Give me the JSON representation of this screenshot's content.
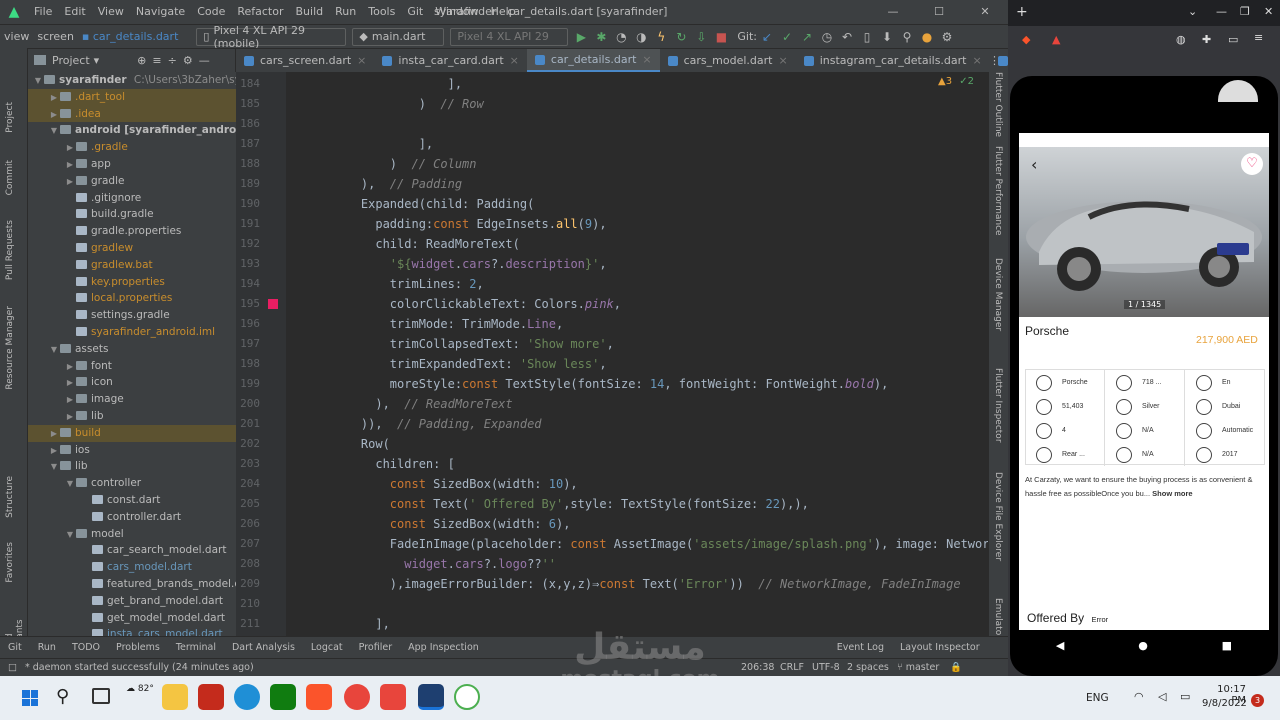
{
  "window": {
    "title": "syarafinder - car_details.dart [syarafinder]",
    "menu": [
      "File",
      "Edit",
      "View",
      "Navigate",
      "Code",
      "Refactor",
      "Build",
      "Run",
      "Tools",
      "Git",
      "Window",
      "Help"
    ],
    "controls": [
      "—",
      "☐",
      "✕"
    ]
  },
  "toolbar": {
    "crumbs": [
      "view",
      "screen"
    ],
    "file": "car_details.dart",
    "device": "Pixel 4 XL API 29 (mobile)",
    "config": "main.dart",
    "target": "Pixel 4 XL API 29",
    "git_label": "Git:"
  },
  "project": {
    "header": "Project",
    "root": "syarafinder",
    "root_path": "C:\\Users\\3bZaher\\syarafin",
    "items": [
      {
        "d": 1,
        "t": ".dart_tool",
        "hl": true,
        "fold": true,
        "col": "#c88d2d"
      },
      {
        "d": 1,
        "t": ".idea",
        "hl": true,
        "fold": true,
        "col": "#c88d2d"
      },
      {
        "d": 1,
        "t": "android [syarafinder_android]",
        "fold": true,
        "open": true,
        "bold": true
      },
      {
        "d": 2,
        "t": ".gradle",
        "fold": true,
        "col": "#c88d2d"
      },
      {
        "d": 2,
        "t": "app",
        "fold": true
      },
      {
        "d": 2,
        "t": "gradle",
        "fold": true
      },
      {
        "d": 2,
        "t": ".gitignore"
      },
      {
        "d": 2,
        "t": "build.gradle"
      },
      {
        "d": 2,
        "t": "gradle.properties"
      },
      {
        "d": 2,
        "t": "gradlew",
        "col": "#c88d2d"
      },
      {
        "d": 2,
        "t": "gradlew.bat",
        "col": "#c88d2d"
      },
      {
        "d": 2,
        "t": "key.properties",
        "col": "#c88d2d"
      },
      {
        "d": 2,
        "t": "local.properties",
        "col": "#c88d2d"
      },
      {
        "d": 2,
        "t": "settings.gradle"
      },
      {
        "d": 2,
        "t": "syarafinder_android.iml",
        "col": "#c88d2d"
      },
      {
        "d": 1,
        "t": "assets",
        "fold": true,
        "open": true
      },
      {
        "d": 2,
        "t": "font",
        "fold": true
      },
      {
        "d": 2,
        "t": "icon",
        "fold": true
      },
      {
        "d": 2,
        "t": "image",
        "fold": true
      },
      {
        "d": 2,
        "t": "lib",
        "fold": true
      },
      {
        "d": 1,
        "t": "build",
        "hl": true,
        "fold": true,
        "col": "#c88d2d"
      },
      {
        "d": 1,
        "t": "ios",
        "fold": true
      },
      {
        "d": 1,
        "t": "lib",
        "fold": true,
        "open": true
      },
      {
        "d": 2,
        "t": "controller",
        "fold": true,
        "open": true
      },
      {
        "d": 3,
        "t": "const.dart"
      },
      {
        "d": 3,
        "t": "controller.dart"
      },
      {
        "d": 2,
        "t": "model",
        "fold": true,
        "open": true
      },
      {
        "d": 3,
        "t": "car_search_model.dart"
      },
      {
        "d": 3,
        "t": "cars_model.dart",
        "col": "#6897bb"
      },
      {
        "d": 3,
        "t": "featured_brands_model.dart"
      },
      {
        "d": 3,
        "t": "get_brand_model.dart"
      },
      {
        "d": 3,
        "t": "get_model_model.dart"
      },
      {
        "d": 3,
        "t": "insta_cars_model.dart",
        "col": "#6897bb"
      }
    ]
  },
  "tabs": [
    "cars_screen.dart",
    "insta_car_card.dart",
    "car_details.dart",
    "cars_model.dart",
    "instagram_car_details.dart",
    "insta_cars_model.dart"
  ],
  "active_tab": 2,
  "inspections": {
    "warnings": "▲3",
    "weak": "✓2"
  },
  "code_lines": [
    {
      "n": 184,
      "h": "                ],"
    },
    {
      "n": 185,
      "h": "            )  <span class='c'>// Row</span>"
    },
    {
      "n": 186,
      "h": ""
    },
    {
      "n": 187,
      "h": "            ],"
    },
    {
      "n": 188,
      "h": "        )  <span class='c'>// Column</span>"
    },
    {
      "n": 189,
      "h": "    ),  <span class='c'>// Padding</span>"
    },
    {
      "n": 190,
      "h": "    Expanded(child: Padding("
    },
    {
      "n": 191,
      "h": "      padding:<span class='k'>const</span> EdgeInsets.<span class='f'>all</span>(<span class='n'>9</span>),"
    },
    {
      "n": 192,
      "h": "      child: ReadMoreText("
    },
    {
      "n": 193,
      "h": "        <span class='s'>'${</span><span class='p'>widget</span>.<span class='p'>cars</span>?.<span class='p'>description</span><span class='s'>}'</span>,"
    },
    {
      "n": 194,
      "h": "        trimLines: <span class='n'>2</span>,"
    },
    {
      "n": 195,
      "h": "        colorClickableText: Colors.<span class='p' style='font-style:italic'>pink</span>,"
    },
    {
      "n": 196,
      "h": "        trimMode: TrimMode.<span class='p'>Line</span>,"
    },
    {
      "n": 197,
      "h": "        trimCollapsedText: <span class='s'>'Show more'</span>,"
    },
    {
      "n": 198,
      "h": "        trimExpandedText: <span class='s'>'Show less'</span>,"
    },
    {
      "n": 199,
      "h": "        moreStyle:<span class='k'>const</span> TextStyle(fontSize: <span class='n'>14</span>, fontWeight: FontWeight.<span class='p' style='font-style:italic'>bold</span>),"
    },
    {
      "n": 200,
      "h": "      ),  <span class='c'>// ReadMoreText</span>"
    },
    {
      "n": 201,
      "h": "    )),  <span class='c'>// Padding, Expanded</span>"
    },
    {
      "n": 202,
      "h": "    Row("
    },
    {
      "n": 203,
      "h": "      children: ["
    },
    {
      "n": 204,
      "h": "        <span class='k'>const</span> SizedBox(width: <span class='n'>10</span>),"
    },
    {
      "n": 205,
      "h": "        <span class='k'>const</span> Text(<span class='s'>' Offered By'</span>,style: TextStyle(fontSize: <span class='n'>22</span>),),"
    },
    {
      "n": 206,
      "h": "        <span class='k'>const</span> SizedBox(width: <span class='n'>6</span>),"
    },
    {
      "n": 207,
      "h": "        FadeInImage(placeholder: <span class='k'>const</span> AssetImage(<span class='s'>'assets/image/splash.png'</span>), image: NetworkI"
    },
    {
      "n": 208,
      "h": "          <span class='p'>widget</span>.<span class='p'>cars</span>?.<span class='p'>logo</span>??<span class='s'>''</span>"
    },
    {
      "n": 209,
      "h": "        ),imageErrorBuilder: (x,y,z)⇒<span class='k'>const</span> Text(<span class='s'>'Error'</span>))  <span class='c'>// NetworkImage, FadeInImage</span>"
    },
    {
      "n": 210,
      "h": ""
    },
    {
      "n": 211,
      "h": "      ],"
    }
  ],
  "bottom_tools": [
    "Git",
    "Run",
    "TODO",
    "Problems",
    "Terminal",
    "Dart Analysis",
    "Logcat",
    "Profiler",
    "App Inspection",
    "Event Log",
    "Layout Inspector"
  ],
  "status": {
    "message": "* daemon started successfully (24 minutes ago)",
    "position": "206:38",
    "line_sep": "CRLF",
    "encoding": "UTF-8",
    "indent": "2 spaces",
    "branch": "master"
  },
  "left_tools": [
    "Project",
    "Commit",
    "Pull Requests",
    "Resource Manager",
    "Structure",
    "Favorites",
    "Build Variants"
  ],
  "right_tools": [
    "Flutter Outline",
    "Flutter Performance",
    "Device Manager",
    "Flutter Inspector",
    "Device File Explorer",
    "Emulator"
  ],
  "phone": {
    "image_counter": "1 / 1345",
    "car_name": "Porsche",
    "price": "217,900 AED",
    "specs": [
      [
        "Porsche",
        "718 ...",
        "En"
      ],
      [
        "51,403",
        "Silver",
        "Dubai"
      ],
      [
        "4",
        "N/A",
        "Automatic"
      ],
      [
        "Rear ...",
        "N/A",
        "2017"
      ]
    ],
    "description": "At Carzaty, we want to ensure the buying process is as convenient & hassle free as possibleOnce you bu...",
    "show_more": "Show more",
    "offered_by": "Offered By",
    "error": "Error",
    "nav": [
      "◀",
      "●",
      "■"
    ]
  },
  "watermark": {
    "arabic": "مستقل",
    "latin": "mostaql.com"
  },
  "taskbar": {
    "lang": "ENG",
    "time": "10:17 PM",
    "date": "9/8/2022",
    "weather": "82°",
    "badge": "3"
  },
  "colors": {
    "accent": "#4a88c7",
    "price": "#e8a33c",
    "pink": "#e91e63",
    "run": "#59a869"
  }
}
